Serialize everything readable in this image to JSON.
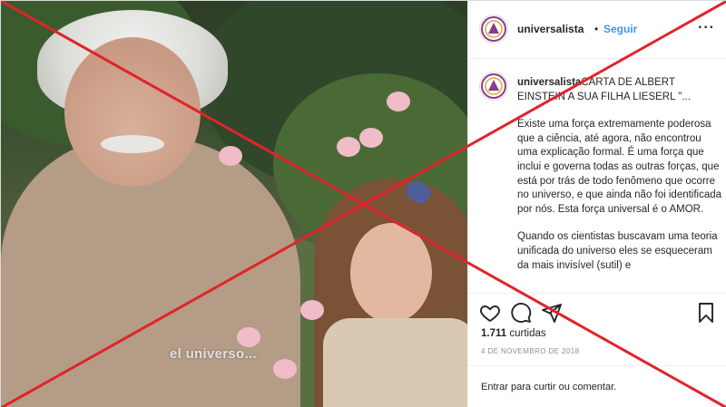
{
  "post": {
    "photo_caption": "el universo...",
    "header": {
      "username": "universalista",
      "separator": "•",
      "follow_label": "Seguir",
      "more_icon": "more-options-icon"
    },
    "caption": {
      "username": "universalista",
      "paragraphs": [
        "CARTA DE ALBERT EINSTEIN A SUA FILHA LIESERL \"...",
        "Existe uma força extremamente poderosa que a ciência, até agora, não encontrou uma explicação formal. É uma força que inclui e governa todas as outras forças, que está por trás de todo fenômeno que ocorre no universo, e que ainda não foi identificada por nós. Esta força universal é o AMOR.",
        "Quando os cientistas buscavam uma teoria unificada do universo eles se esqueceram da mais invisível (sutil) e"
      ]
    },
    "actions": {
      "icons": [
        "heart-icon",
        "comment-icon",
        "share-icon",
        "bookmark-icon"
      ]
    },
    "likes": {
      "count": "1.711",
      "label": " curtidas"
    },
    "date": "4 DE NOVEMBRO DE 2018",
    "comment_prompt": {
      "login_link": "Entrar",
      "text": " para curtir ou comentar."
    },
    "colors": {
      "accent": "#3897f0",
      "cross": "#e0242a",
      "text": "#262626",
      "muted": "#8e8e8e"
    }
  }
}
